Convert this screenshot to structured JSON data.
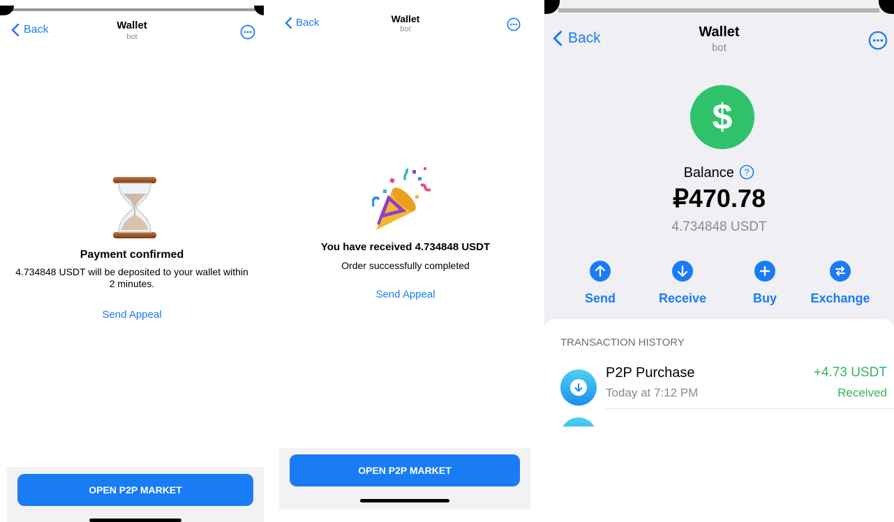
{
  "screens": [
    {
      "nav": {
        "back_label": "Back",
        "title": "Wallet",
        "subtitle": "bot"
      },
      "heading": "Payment confirmed",
      "message": "4.734848 USDT will be deposited to your wallet within 2 minutes.",
      "appeal_label": "Send Appeal",
      "button_label": "OPEN P2P MARKET"
    },
    {
      "nav": {
        "back_label": "Back",
        "title": "Wallet",
        "subtitle": "bot"
      },
      "heading": "You have received 4.734848 USDT",
      "message": "Order successfully completed",
      "appeal_label": "Send Appeal",
      "button_label": "OPEN P2P MARKET"
    },
    {
      "nav": {
        "back_label": "Back",
        "title": "Wallet",
        "subtitle": "bot"
      },
      "balance_label": "Balance",
      "balance_amount": "₽470.78",
      "balance_crypto": "4.734848 USDT",
      "actions": [
        {
          "label": "Send",
          "icon": "arrow-up-icon"
        },
        {
          "label": "Receive",
          "icon": "arrow-down-icon"
        },
        {
          "label": "Buy",
          "icon": "plus-icon"
        },
        {
          "label": "Exchange",
          "icon": "exchange-icon"
        }
      ],
      "history_title": "TRANSACTION HISTORY",
      "transactions": [
        {
          "title": "P2P Purchase",
          "time": "Today at 7:12 PM",
          "amount": "+4.73 USDT",
          "status": "Received"
        }
      ]
    }
  ],
  "colors": {
    "accent": "#1a7cf5",
    "positive": "#34b35a",
    "dollar_green": "#2fc26b",
    "wallet_bg": "#efeff4"
  }
}
